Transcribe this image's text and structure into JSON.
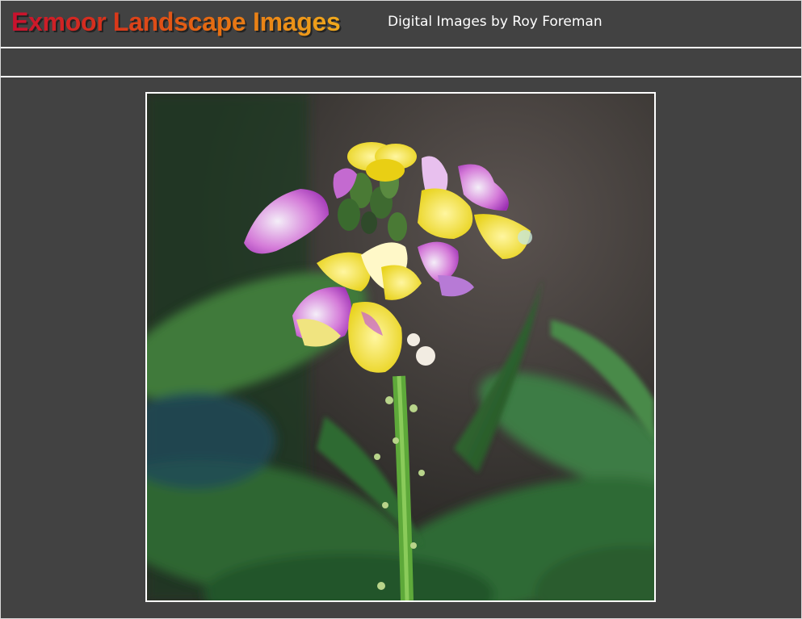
{
  "header": {
    "site_title": "Exmoor Landscape Images",
    "subtitle": "Digital Images by Roy Foreman"
  },
  "photo": {
    "subject": "flower-photo",
    "colors": {
      "title_gradient_start": "#c8102e",
      "title_gradient_end": "#f0a91c",
      "background": "#424242",
      "border": "#ffffff"
    }
  }
}
